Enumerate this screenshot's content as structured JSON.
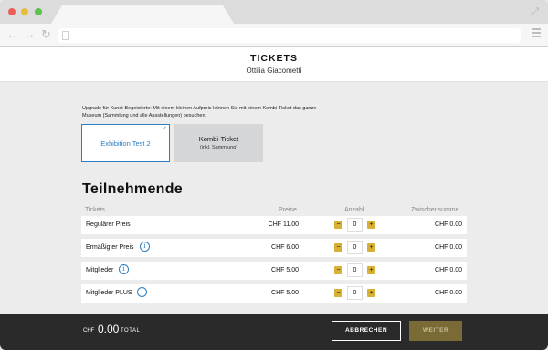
{
  "header": {
    "title": "TICKETS",
    "subtitle": "Ottilia Giacometti"
  },
  "upgrade": {
    "text": "Upgrade für Kunst-Begeisterte: Mit einem kleinen Aufpreis können Sie mit einem Kombi-Ticket das ganze Museum (Sammlung und alle Ausstellungen) besuchen."
  },
  "options": {
    "selected": {
      "label": "Exhibition Test 2"
    },
    "kombi": {
      "label": "Kombi-Ticket",
      "sub": "(inkl. Sammlung)"
    }
  },
  "section_title": "Teilnehmende",
  "columns": {
    "tickets": "Tickets",
    "preise": "Preise",
    "anzahl": "Anzahl",
    "zwischensumme": "Zwischensumme"
  },
  "rows": [
    {
      "name": "Regulärer Preis",
      "price": "CHF 11.00",
      "qty": "0",
      "subtotal": "CHF 0.00"
    },
    {
      "name": "Ermäßigter Preis",
      "price": "CHF 6.00",
      "qty": "0",
      "subtotal": "CHF 0.00"
    },
    {
      "name": "Mitglieder",
      "price": "CHF 5.00",
      "qty": "0",
      "subtotal": "CHF 0.00"
    },
    {
      "name": "Mitglieder PLUS",
      "price": "CHF 5.00",
      "qty": "0",
      "subtotal": "CHF 0.00"
    }
  ],
  "footer": {
    "currency": "CHF",
    "amount": "0.00",
    "total_label": "TOTAL",
    "cancel_label": "ABBRECHEN",
    "next_label": "WEITER"
  },
  "symbols": {
    "minus": "−",
    "plus": "+",
    "info": "i",
    "check": "✓",
    "back": "←",
    "forward": "→",
    "reload": "↻",
    "expand": "⤢"
  },
  "colors": {
    "accent_blue": "#2a7ec4",
    "stepper_gold": "#d9b036",
    "footer_bg": "#2a2a2a",
    "next_button": "#7a6a36"
  }
}
